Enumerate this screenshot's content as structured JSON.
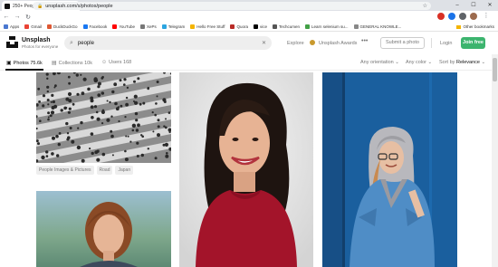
{
  "browser": {
    "tab_title": "250+ People Pictures [HQ] | Dow",
    "url": "unsplash.com/s/photos/people",
    "bookmarks": [
      {
        "label": "Apps",
        "color": "#4a78d0"
      },
      {
        "label": "Gmail",
        "color": "#ea4335"
      },
      {
        "label": "DuckDuckGo",
        "color": "#de5833"
      },
      {
        "label": "Facebook",
        "color": "#1877f2"
      },
      {
        "label": "YouTube",
        "color": "#ff0000"
      },
      {
        "label": "XePs",
        "color": "#777777"
      },
      {
        "label": "Telegram",
        "color": "#2ca5e0"
      },
      {
        "label": "Hello Free Stuff",
        "color": "#f4b400"
      },
      {
        "label": "Quora",
        "color": "#b92b27"
      },
      {
        "label": "vice",
        "color": "#000000"
      },
      {
        "label": "Techcumen",
        "color": "#555555"
      },
      {
        "label": "Learn selenium su...",
        "color": "#43a047"
      },
      {
        "label": "GENERAL KNOWLE...",
        "color": "#888888"
      }
    ],
    "other_bookmarks": "Other bookmarks"
  },
  "header": {
    "brand": "Unsplash",
    "tagline": "Photos for everyone",
    "search_value": "people",
    "explore": "Explore",
    "awards": "Unsplash Awards",
    "more": "•••",
    "submit": "Submit a photo",
    "login": "Login",
    "join": "Join free"
  },
  "subnav": {
    "photos": "Photos 75.6k",
    "collections": "Collections 10k",
    "users": "Users 168",
    "orientation": "Any orientation",
    "color": "Any color",
    "sort_prefix": "Sort by",
    "sort_value": "Relevance"
  },
  "photo_tags": [
    "People Images & Pictures",
    "Road",
    "Japan"
  ],
  "colors": {
    "join_button": "#3cb46e",
    "blue_wall": "#1a5f9e",
    "red_top": "#a3142a"
  }
}
